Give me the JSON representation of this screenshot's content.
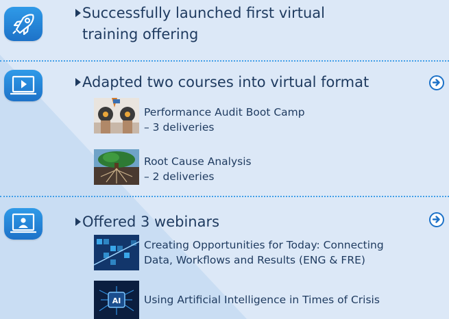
{
  "items": [
    {
      "title": "Successfully launched first virtual\ntraining offering",
      "icon": "rocket-icon"
    },
    {
      "title": "Adapted two courses into virtual format",
      "icon": "video-screen-icon",
      "subitems": [
        {
          "text": "Performance Audit Boot Camp\n– 3 deliveries",
          "image": "boot-camp-thumbnail"
        },
        {
          "text": "Root Cause Analysis\n– 2 deliveries",
          "image": "tree-roots-thumbnail"
        }
      ]
    },
    {
      "title": "Offered 3 webinars",
      "icon": "presenter-screen-icon",
      "subitems": [
        {
          "text": "Creating Opportunities for Today: Connecting\nData, Workflows and Results (ENG & FRE)",
          "image": "data-workflow-thumbnail"
        },
        {
          "text": "Using Artificial Intelligence in Times of Crisis",
          "image": "ai-chip-thumbnail"
        }
      ]
    }
  ],
  "colors": {
    "accent": "#1d72c8",
    "text": "#1e3a5f",
    "background": "#dce8f7"
  }
}
